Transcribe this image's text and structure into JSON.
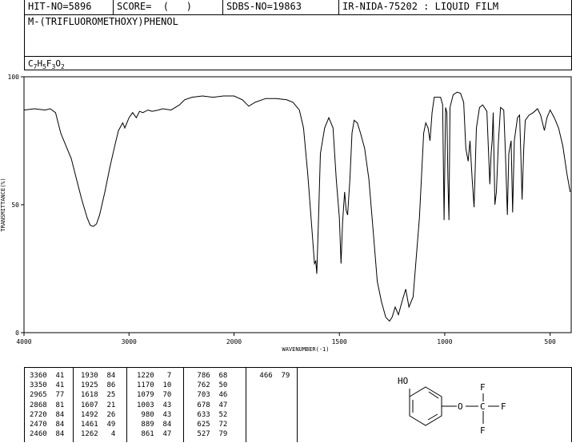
{
  "header": {
    "hit_no": "HIT-NO=5896",
    "score": "SCORE=  (   )",
    "sdbs_no": "SDBS-NO=19863",
    "ir_nida": "IR-NIDA-75202 : LIQUID FILM"
  },
  "compound_name": "M-(TRIFLUOROMETHOXY)PHENOL",
  "formula": {
    "parts": [
      {
        "text": "C",
        "sub": "7"
      },
      {
        "text": "H",
        "sub": "5"
      },
      {
        "text": "F",
        "sub": "3"
      },
      {
        "text": "O",
        "sub": "2"
      }
    ]
  },
  "chart_data": {
    "type": "line",
    "xlabel": "WAVENUMBER(-1)",
    "ylabel": "TRANSMITTANCE(%)",
    "xlim": [
      4000,
      400
    ],
    "ylim": [
      0,
      100
    ],
    "x_ticks": [
      4000,
      3000,
      2000,
      1500,
      1000,
      500
    ],
    "y_ticks": [
      0,
      50,
      100
    ],
    "series": [
      {
        "points": [
          [
            4000,
            87
          ],
          [
            3900,
            87.5
          ],
          [
            3800,
            87
          ],
          [
            3750,
            87.5
          ],
          [
            3700,
            86
          ],
          [
            3650,
            78
          ],
          [
            3600,
            73
          ],
          [
            3550,
            68
          ],
          [
            3500,
            60
          ],
          [
            3450,
            52
          ],
          [
            3400,
            45
          ],
          [
            3370,
            42
          ],
          [
            3340,
            41.5
          ],
          [
            3310,
            42.5
          ],
          [
            3280,
            46
          ],
          [
            3230,
            55
          ],
          [
            3180,
            65
          ],
          [
            3130,
            74
          ],
          [
            3100,
            79
          ],
          [
            3060,
            82
          ],
          [
            3040,
            80
          ],
          [
            3000,
            84
          ],
          [
            2965,
            86
          ],
          [
            2930,
            84
          ],
          [
            2900,
            86.5
          ],
          [
            2868,
            86
          ],
          [
            2820,
            87
          ],
          [
            2780,
            86.5
          ],
          [
            2720,
            87
          ],
          [
            2680,
            87.5
          ],
          [
            2600,
            87
          ],
          [
            2520,
            89
          ],
          [
            2470,
            91
          ],
          [
            2400,
            92
          ],
          [
            2300,
            92.5
          ],
          [
            2200,
            92
          ],
          [
            2100,
            92.5
          ],
          [
            2000,
            92.5
          ],
          [
            1960,
            91
          ],
          [
            1930,
            88.5
          ],
          [
            1900,
            90
          ],
          [
            1850,
            91.5
          ],
          [
            1800,
            91.5
          ],
          [
            1750,
            91
          ],
          [
            1720,
            90
          ],
          [
            1690,
            87
          ],
          [
            1670,
            80
          ],
          [
            1650,
            62
          ],
          [
            1630,
            40
          ],
          [
            1618,
            27
          ],
          [
            1612,
            28
          ],
          [
            1607,
            23
          ],
          [
            1600,
            42
          ],
          [
            1590,
            70
          ],
          [
            1570,
            80
          ],
          [
            1550,
            84
          ],
          [
            1530,
            80
          ],
          [
            1515,
            60
          ],
          [
            1500,
            45
          ],
          [
            1492,
            27
          ],
          [
            1485,
            43
          ],
          [
            1475,
            55
          ],
          [
            1468,
            48
          ],
          [
            1461,
            46
          ],
          [
            1450,
            60
          ],
          [
            1440,
            78
          ],
          [
            1430,
            83
          ],
          [
            1415,
            82
          ],
          [
            1400,
            78
          ],
          [
            1380,
            72
          ],
          [
            1360,
            60
          ],
          [
            1340,
            40
          ],
          [
            1320,
            20
          ],
          [
            1300,
            12
          ],
          [
            1280,
            6
          ],
          [
            1262,
            4.5
          ],
          [
            1250,
            6
          ],
          [
            1235,
            10
          ],
          [
            1220,
            7
          ],
          [
            1200,
            13
          ],
          [
            1185,
            17
          ],
          [
            1170,
            10
          ],
          [
            1150,
            14
          ],
          [
            1120,
            45
          ],
          [
            1100,
            78
          ],
          [
            1090,
            82
          ],
          [
            1079,
            80
          ],
          [
            1070,
            75
          ],
          [
            1060,
            86
          ],
          [
            1050,
            92
          ],
          [
            1020,
            92
          ],
          [
            1010,
            89
          ],
          [
            1003,
            44
          ],
          [
            996,
            88
          ],
          [
            990,
            86
          ],
          [
            985,
            60
          ],
          [
            980,
            44
          ],
          [
            975,
            88
          ],
          [
            960,
            93
          ],
          [
            940,
            94
          ],
          [
            925,
            93.5
          ],
          [
            910,
            90
          ],
          [
            900,
            72
          ],
          [
            889,
            67
          ],
          [
            880,
            75
          ],
          [
            870,
            60
          ],
          [
            861,
            49
          ],
          [
            850,
            80
          ],
          [
            835,
            88
          ],
          [
            820,
            89
          ],
          [
            800,
            86.5
          ],
          [
            786,
            58
          ],
          [
            780,
            70
          ],
          [
            775,
            75
          ],
          [
            770,
            86
          ],
          [
            762,
            50
          ],
          [
            755,
            55
          ],
          [
            745,
            75
          ],
          [
            735,
            88
          ],
          [
            720,
            87
          ],
          [
            712,
            70
          ],
          [
            703,
            46
          ],
          [
            696,
            70
          ],
          [
            685,
            75
          ],
          [
            678,
            47
          ],
          [
            670,
            75
          ],
          [
            655,
            84
          ],
          [
            645,
            85
          ],
          [
            639,
            70
          ],
          [
            633,
            52
          ],
          [
            625,
            72
          ],
          [
            618,
            83
          ],
          [
            600,
            85
          ],
          [
            580,
            86
          ],
          [
            560,
            87.5
          ],
          [
            545,
            85
          ],
          [
            527,
            79
          ],
          [
            515,
            84
          ],
          [
            500,
            87
          ],
          [
            480,
            84
          ],
          [
            460,
            80
          ],
          [
            440,
            73
          ],
          [
            420,
            62
          ],
          [
            405,
            55
          ]
        ]
      }
    ]
  },
  "peak_table": {
    "columns": [
      [
        [
          "3360",
          "41"
        ],
        [
          "3350",
          "41"
        ],
        [
          "2965",
          "77"
        ],
        [
          "2868",
          "81"
        ],
        [
          "2720",
          "84"
        ],
        [
          "2470",
          "84"
        ],
        [
          "2460",
          "84"
        ]
      ],
      [
        [
          "1930",
          "84"
        ],
        [
          "1925",
          "86"
        ],
        [
          "1618",
          "25"
        ],
        [
          "1607",
          "21"
        ],
        [
          "1492",
          "26"
        ],
        [
          "1461",
          "49"
        ],
        [
          "1262",
          "4"
        ]
      ],
      [
        [
          "1220",
          "7"
        ],
        [
          "1170",
          "10"
        ],
        [
          "1079",
          "70"
        ],
        [
          "1003",
          "43"
        ],
        [
          "980",
          "43"
        ],
        [
          "889",
          "84"
        ],
        [
          "861",
          "47"
        ]
      ],
      [
        [
          "786",
          "68"
        ],
        [
          "762",
          "50"
        ],
        [
          "703",
          "46"
        ],
        [
          "678",
          "47"
        ],
        [
          "633",
          "52"
        ],
        [
          "625",
          "72"
        ],
        [
          "527",
          "79"
        ]
      ],
      [
        [
          "466",
          "79"
        ]
      ]
    ]
  },
  "structure": {
    "labels": {
      "oh": "HO",
      "o": "O",
      "c": "C",
      "f_top": "F",
      "f_right": "F",
      "f_bottom": "F"
    }
  }
}
